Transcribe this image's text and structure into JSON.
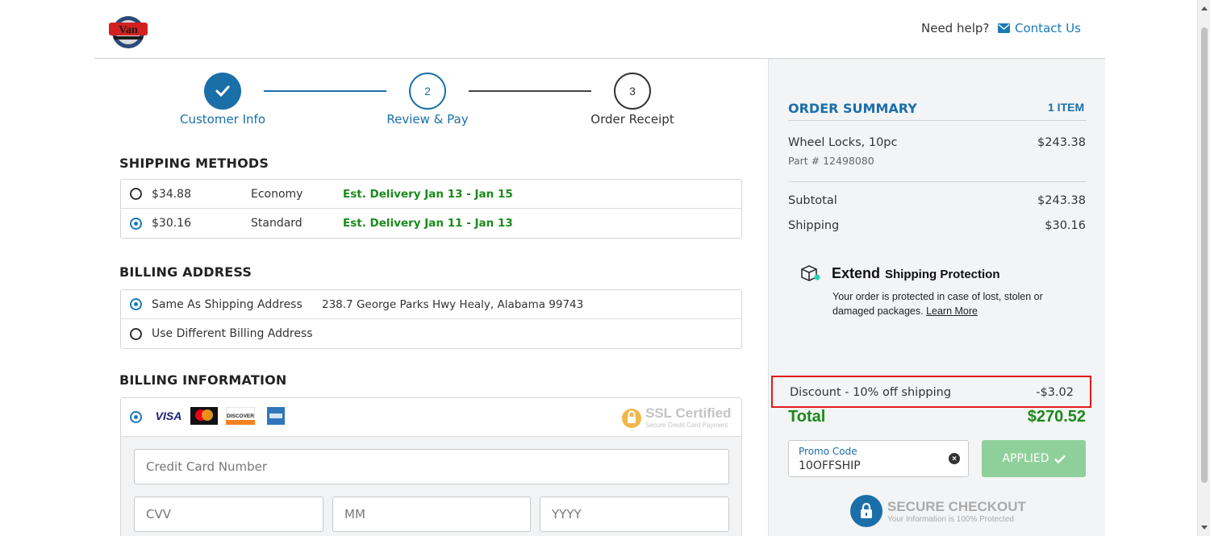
{
  "header": {
    "need_help": "Need help?",
    "contact_us": "Contact Us"
  },
  "stepper": {
    "steps": [
      {
        "label": "Customer Info",
        "status": "completed"
      },
      {
        "label": "Review & Pay",
        "number": "2",
        "status": "current"
      },
      {
        "label": "Order Receipt",
        "number": "3",
        "status": "upcoming"
      }
    ]
  },
  "shipping": {
    "title": "SHIPPING METHODS",
    "options": [
      {
        "price": "$34.88",
        "name": "Economy",
        "delivery": "Est. Delivery Jan 13 - Jan 15",
        "selected": false
      },
      {
        "price": "$30.16",
        "name": "Standard",
        "delivery": "Est. Delivery Jan 11 - Jan 13",
        "selected": true
      }
    ]
  },
  "billing_address": {
    "title": "BILLING ADDRESS",
    "options": [
      {
        "label": "Same As Shipping Address",
        "address": "238.7 George Parks Hwy Healy, Alabama 99743",
        "selected": true
      },
      {
        "label": "Use Different Billing Address",
        "selected": false
      }
    ]
  },
  "billing_info": {
    "title": "BILLING INFORMATION",
    "cards": [
      "VISA",
      "mastercard",
      "DISCOVER",
      "AMEX"
    ],
    "ssl_title": "SSL Certified",
    "ssl_sub": "Secure Credit Card Payment",
    "card_number_placeholder": "Credit Card Number",
    "cvv_placeholder": "CVV",
    "mm_placeholder": "MM",
    "yyyy_placeholder": "YYYY"
  },
  "order_summary": {
    "title": "ORDER SUMMARY",
    "item_count": "1 ITEM",
    "item_name": "Wheel Locks, 10pc",
    "item_part": "Part # 12498080",
    "item_price": "$243.38",
    "subtotal_label": "Subtotal",
    "subtotal": "$243.38",
    "shipping_label": "Shipping",
    "shipping": "$30.16",
    "extend_brand": "Extend",
    "extend_tag": "Shipping Protection",
    "extend_text": "Your order is protected in case of lost, stolen or damaged packages.",
    "extend_link": "Learn More",
    "discount_label": "Discount - 10% off shipping",
    "discount": "-$3.02",
    "total_label": "Total",
    "total": "$270.52",
    "promo_label": "Promo Code",
    "promo_value": "10OFFSHIP",
    "applied_label": "APPLIED",
    "secure_title": "SECURE CHECKOUT",
    "secure_sub": "Your Information is 100% Protected"
  },
  "colors": {
    "primary_blue": "#1a6fa9",
    "success_green": "#1a8a1a",
    "highlight_red": "#e31b1b",
    "applied_green": "#8fd09a"
  }
}
